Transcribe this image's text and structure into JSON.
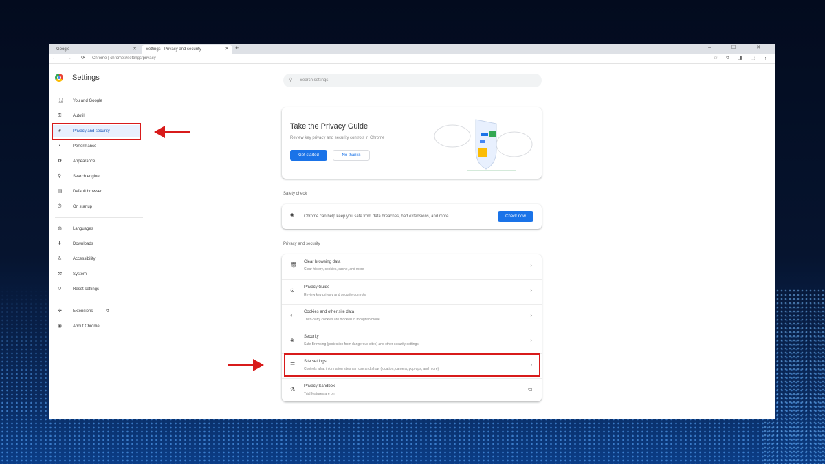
{
  "browser": {
    "tabs": [
      {
        "label": "Google"
      },
      {
        "label": "Settings - Privacy and security"
      }
    ],
    "new_tab": "+",
    "window_controls": "– ☐ ✕",
    "nav_icons": "← → ⟳",
    "url": "Chrome | chrome://settings/privacy",
    "ext_icons": "☆ ⧉ ◨ ⬚ ⋮"
  },
  "sidebar": {
    "title": "Settings",
    "items": [
      {
        "label": "You and Google",
        "icon": "person-icon"
      },
      {
        "label": "Autofill",
        "icon": "key-icon"
      },
      {
        "label": "Privacy and security",
        "icon": "shield-icon"
      },
      {
        "label": "Performance",
        "icon": "speedometer-icon"
      },
      {
        "label": "Appearance",
        "icon": "palette-icon"
      },
      {
        "label": "Search engine",
        "icon": "search-icon"
      },
      {
        "label": "Default browser",
        "icon": "browser-icon"
      },
      {
        "label": "On startup",
        "icon": "power-icon"
      },
      {
        "label": "Languages",
        "icon": "globe-icon"
      },
      {
        "label": "Downloads",
        "icon": "download-icon"
      },
      {
        "label": "Accessibility",
        "icon": "accessibility-icon"
      },
      {
        "label": "System",
        "icon": "wrench-icon"
      },
      {
        "label": "Reset settings",
        "icon": "reset-icon"
      },
      {
        "label": "Extensions",
        "icon": "puzzle-icon"
      },
      {
        "label": "About Chrome",
        "icon": "chrome-icon"
      }
    ]
  },
  "search": {
    "placeholder": "Search settings"
  },
  "privacy_guide": {
    "title": "Take the Privacy Guide",
    "description": "Review key privacy and security controls in Chrome",
    "primary_button": "Get started",
    "secondary_button": "No thanks"
  },
  "safety_check": {
    "heading": "Safety check",
    "text": "Chrome can help keep you safe from data breaches, bad extensions, and more",
    "button": "Check now"
  },
  "privacy_section": {
    "heading": "Privacy and security",
    "rows": [
      {
        "title": "Clear browsing data",
        "subtitle": "Clear history, cookies, cache, and more",
        "icon": "trash-icon"
      },
      {
        "title": "Privacy Guide",
        "subtitle": "Review key privacy and security controls",
        "icon": "compass-icon"
      },
      {
        "title": "Cookies and other site data",
        "subtitle": "Third-party cookies are blocked in Incognito mode",
        "icon": "cookie-icon"
      },
      {
        "title": "Security",
        "subtitle": "Safe Browsing (protection from dangerous sites) and other security settings",
        "icon": "security-icon"
      },
      {
        "title": "Site settings",
        "subtitle": "Controls what information sites can use and show (location, camera, pop-ups, and more)",
        "icon": "sliders-icon"
      },
      {
        "title": "Privacy Sandbox",
        "subtitle": "Trial features are on",
        "icon": "flask-icon"
      }
    ]
  },
  "colors": {
    "accent": "#1a73e8",
    "highlight": "#d81b1b"
  }
}
